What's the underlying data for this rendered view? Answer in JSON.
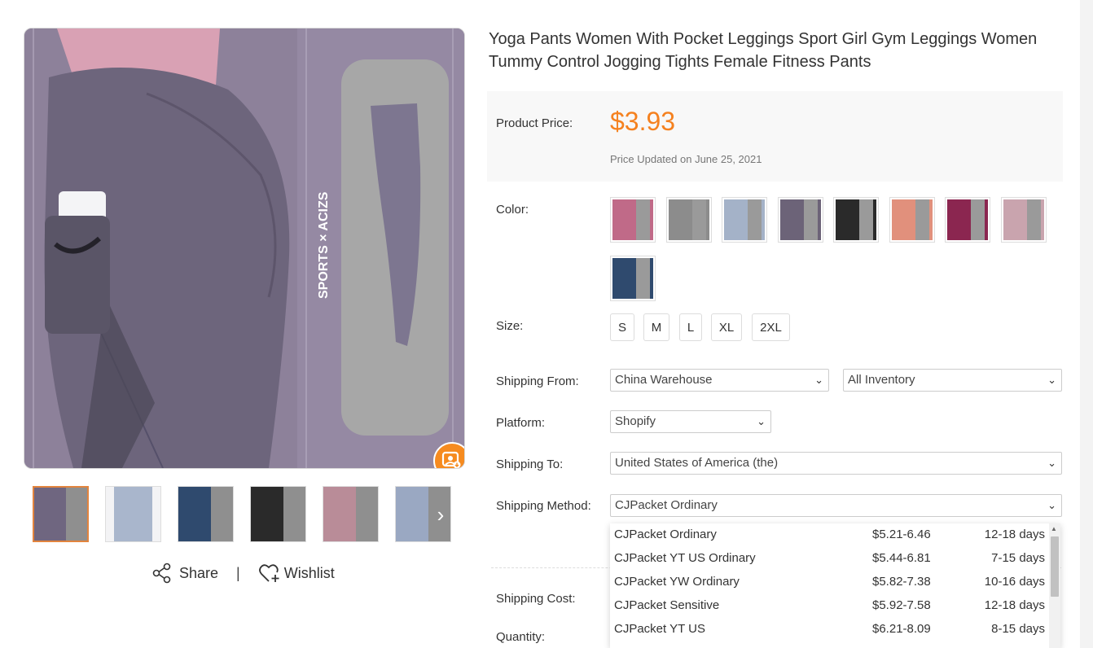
{
  "product": {
    "title": "Yoga Pants Women With Pocket Leggings Sport Girl Gym Leggings Women Tummy Control Jogging Tights Female Fitness Pants",
    "image_brand_text": "SPORTS × ACIZS"
  },
  "price": {
    "label": "Product Price:",
    "value": "$3.93",
    "updated": "Price Updated on June 25, 2021",
    "accent_color": "#f5811f"
  },
  "color": {
    "label": "Color:",
    "swatches": [
      "#c06a88",
      "#8c8c8c",
      "#a4b2c8",
      "#6c6378",
      "#2a2a2a",
      "#e1907c",
      "#8b2650",
      "#c9a4ae",
      "#2f4a6e"
    ]
  },
  "size": {
    "label": "Size:",
    "options": [
      "S",
      "M",
      "L",
      "XL",
      "2XL"
    ]
  },
  "shipping_from": {
    "label": "Shipping From:",
    "warehouse": "China Warehouse",
    "inventory": "All Inventory"
  },
  "platform": {
    "label": "Platform:",
    "value": "Shopify"
  },
  "shipping_to": {
    "label": "Shipping To:",
    "value": "United States of America (the)"
  },
  "shipping_method": {
    "label": "Shipping Method:",
    "value": "CJPacket Ordinary",
    "options": [
      {
        "name": "CJPacket Ordinary",
        "price": "$5.21-6.46",
        "days": "12-18 days"
      },
      {
        "name": "CJPacket YT US Ordinary",
        "price": "$5.44-6.81",
        "days": "7-15 days"
      },
      {
        "name": "CJPacket YW Ordinary",
        "price": "$5.82-7.38",
        "days": "10-16 days"
      },
      {
        "name": "CJPacket Sensitive",
        "price": "$5.92-7.58",
        "days": "12-18 days"
      },
      {
        "name": "CJPacket YT US",
        "price": "$6.21-8.09",
        "days": "8-15 days"
      }
    ]
  },
  "shipping_cost": {
    "label": "Shipping Cost:"
  },
  "quantity": {
    "label": "Quantity:"
  },
  "actions": {
    "share": "Share",
    "separator": "|",
    "wishlist": "Wishlist"
  },
  "thumbnails": [
    "#6f6680",
    "#a9b6cc",
    "#2f4a6e",
    "#2a2a2a",
    "#b98c98",
    "#9aa8c2"
  ]
}
